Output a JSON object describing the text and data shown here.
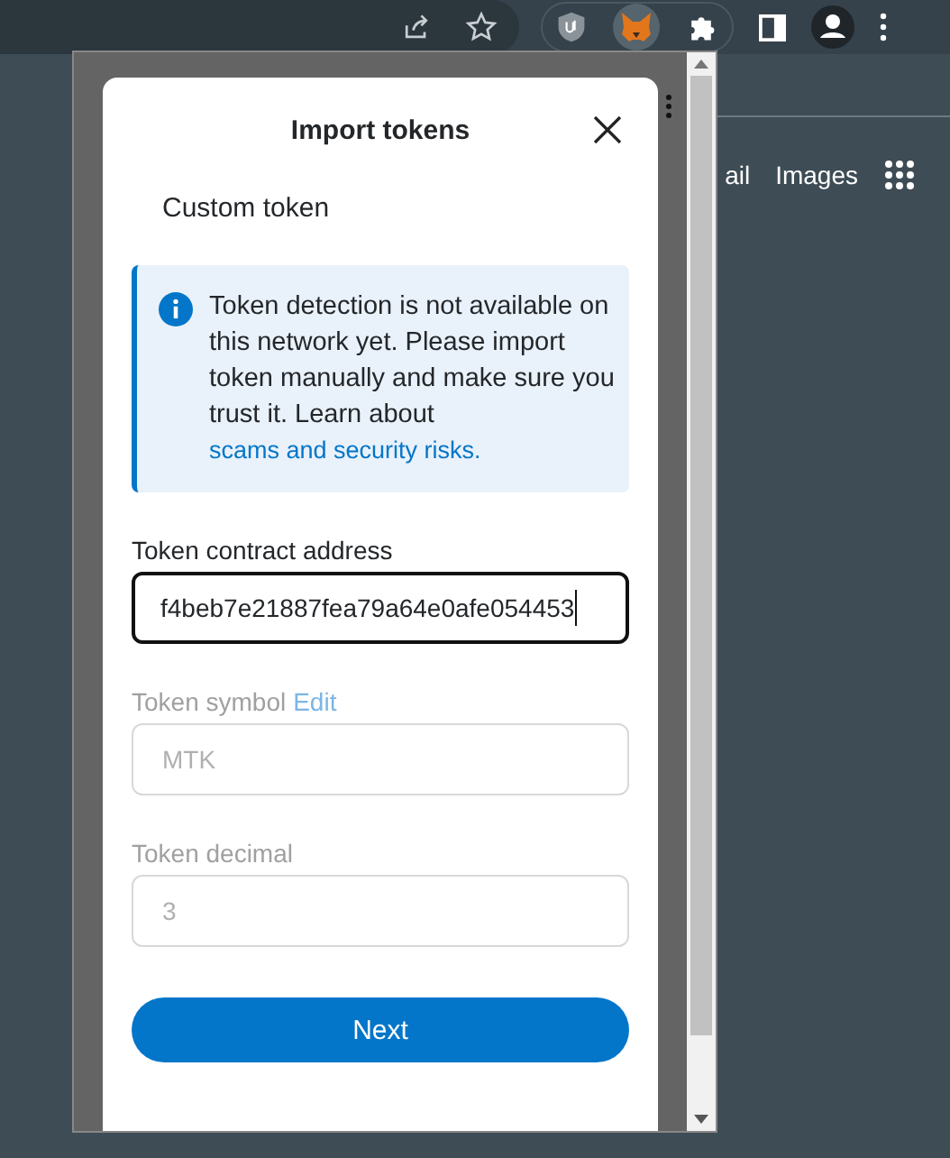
{
  "page": {
    "links": [
      "ail",
      "Images"
    ]
  },
  "popup": {
    "title": "Import tokens",
    "tab": {
      "label": "Custom token",
      "selected": true
    },
    "notice": {
      "text": "Token detection is not available on this network yet. Please import token manually and make sure you trust it. Learn about",
      "link": "scams and security risks."
    },
    "fields": [
      {
        "label": "Token contract address",
        "value": "f4beb7e21887fea79a64e0afe054453",
        "disabled": false,
        "focused": true
      },
      {
        "label": "Token symbol",
        "edit_link": "Edit",
        "value": "MTK",
        "disabled": true,
        "focused": false
      },
      {
        "label": "Token decimal",
        "value": "3",
        "disabled": true,
        "focused": false
      }
    ],
    "button": "Next"
  }
}
